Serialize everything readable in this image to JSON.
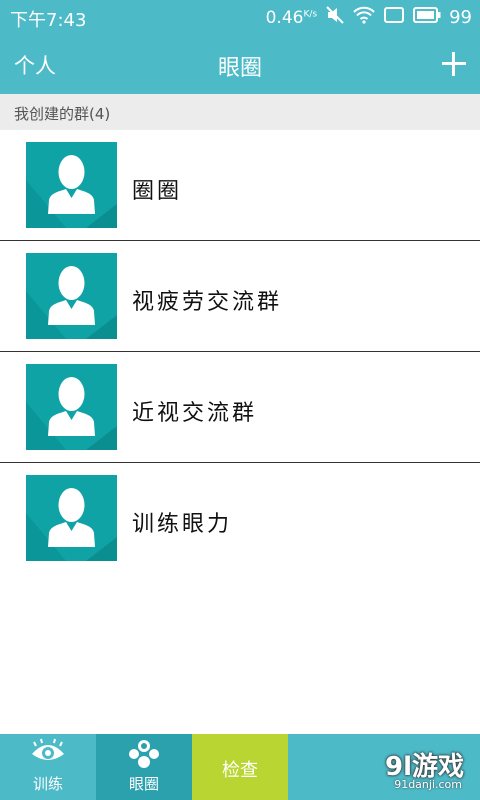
{
  "status_bar": {
    "time": "下午7:43",
    "speed": "0.46",
    "speed_unit": "K/s",
    "battery": "99"
  },
  "header": {
    "left_link": "个人",
    "title": "眼圈"
  },
  "section": {
    "title": "我创建的群(4)"
  },
  "groups": [
    {
      "name": "圈圈"
    },
    {
      "name": "视疲劳交流群"
    },
    {
      "name": "近视交流群"
    },
    {
      "name": "训练眼力"
    }
  ],
  "bottom_nav": {
    "train": "训练",
    "group": "眼圈",
    "check": "检查"
  },
  "watermark": {
    "brand": "9l游戏",
    "site": "91danji.com"
  },
  "colors": {
    "primary": "#4dbac8",
    "avatar": "#0fa3a6",
    "check": "#b9d531"
  }
}
